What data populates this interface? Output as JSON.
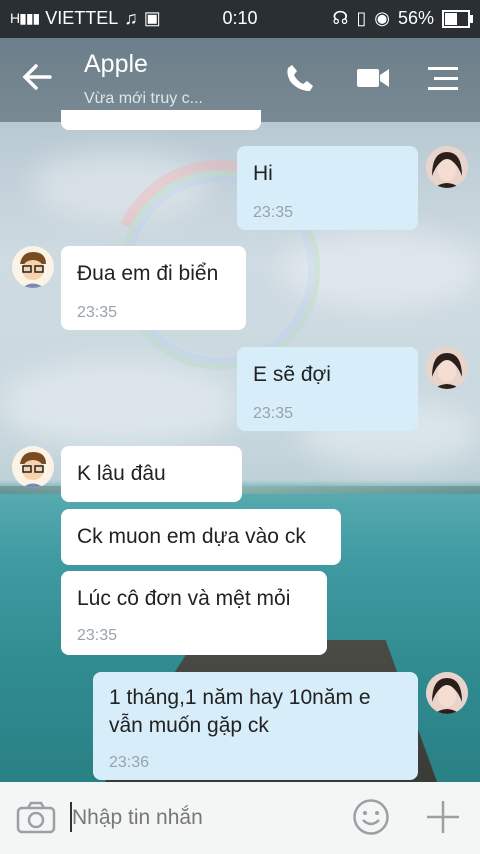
{
  "status_bar": {
    "carrier": "VIETTEL",
    "time": "0:10",
    "battery": "56%",
    "battery_level": 0.56
  },
  "header": {
    "title": "Apple",
    "subtitle": "Vừa mới truy c..."
  },
  "messages": [
    {
      "side": "out",
      "text": "Hi",
      "time": "23:35"
    },
    {
      "side": "in",
      "text": "Đua em đi biển",
      "time": "23:35"
    },
    {
      "side": "out",
      "text": "E sẽ đợi",
      "time": "23:35"
    },
    {
      "side": "in",
      "text": "K lâu đâu",
      "time": ""
    },
    {
      "side": "in",
      "text": "Ck muon em dựa vào ck",
      "time": ""
    },
    {
      "side": "in",
      "text": "Lúc cô đơn và mệt mỏi",
      "time": "23:35"
    },
    {
      "side": "out",
      "text_line1": "1 tháng,1 năm hay 10năm e",
      "text_line2": "vẫn muốn gặp ck",
      "time": "23:36"
    }
  ],
  "composer": {
    "placeholder": "Nhập tin nhắn"
  },
  "icons": {
    "back": "arrow-left-icon",
    "call": "phone-icon",
    "video": "video-camera-icon",
    "menu": "menu-icon",
    "camera": "camera-icon",
    "emoji": "smiley-icon",
    "add": "plus-icon"
  }
}
